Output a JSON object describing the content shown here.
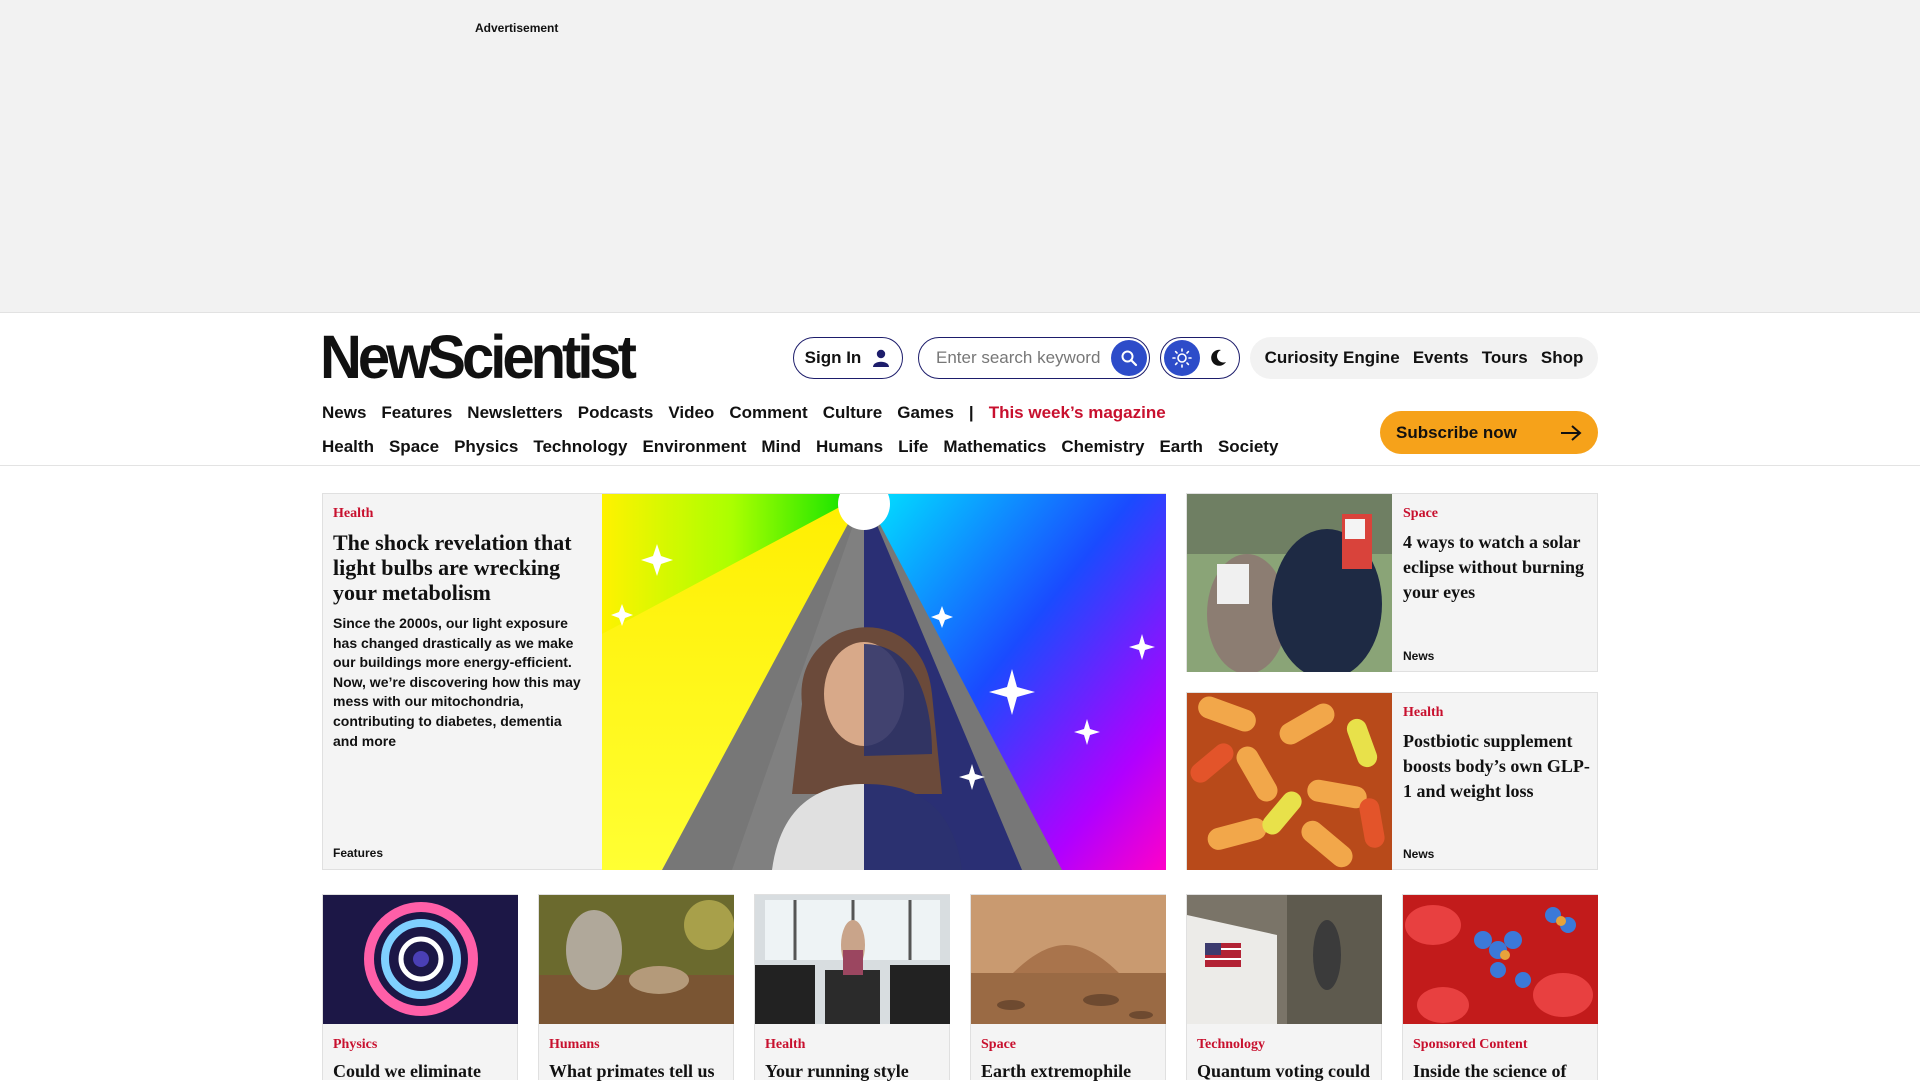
{
  "ad": {
    "label": "Advertisement"
  },
  "brand": {
    "logo": "NewScientist"
  },
  "header": {
    "signin": "Sign In",
    "search_placeholder": "Enter search keywords",
    "utility_links": [
      "Curiosity Engine",
      "Events",
      "Tours",
      "Shop"
    ],
    "subscribe": "Subscribe now"
  },
  "nav_primary": [
    "News",
    "Features",
    "Newsletters",
    "Podcasts",
    "Video",
    "Comment",
    "Culture",
    "Games",
    "|"
  ],
  "nav_magazine": "This week’s magazine",
  "nav_topics": [
    "Health",
    "Space",
    "Physics",
    "Technology",
    "Environment",
    "Mind",
    "Humans",
    "Life",
    "Mathematics",
    "Chemistry",
    "Earth",
    "Society"
  ],
  "lead": {
    "category": "Health",
    "title": "The shock revelation that light bulbs are wrecking your metabolism",
    "standfirst": "Since the 2000s, our light exposure has changed drastically as we make our buildings more energy-efficient. Now, we’re discovering how this may mess with our mitochondria, contributing to diabetes, dementia and more",
    "type": "Features"
  },
  "side_stories": [
    {
      "category": "Space",
      "title": "4 ways to watch a solar eclipse without burning your eyes",
      "type": "News"
    },
    {
      "category": "Health",
      "title": "Postbiotic supplement boosts body’s own GLP-1 and weight loss",
      "type": "News"
    }
  ],
  "grid": [
    {
      "category": "Physics",
      "title": "Could we eliminate"
    },
    {
      "category": "Humans",
      "title": "What primates tell us"
    },
    {
      "category": "Health",
      "title": "Your running style"
    },
    {
      "category": "Space",
      "title": "Earth extremophile"
    },
    {
      "category": "Technology",
      "title": "Quantum voting could"
    },
    {
      "category": "Sponsored Content",
      "title": "Inside the science of"
    }
  ],
  "colors": {
    "accent": "#c8102e",
    "subscribe": "#f6a21a",
    "button_blue": "#2d4cc9"
  }
}
